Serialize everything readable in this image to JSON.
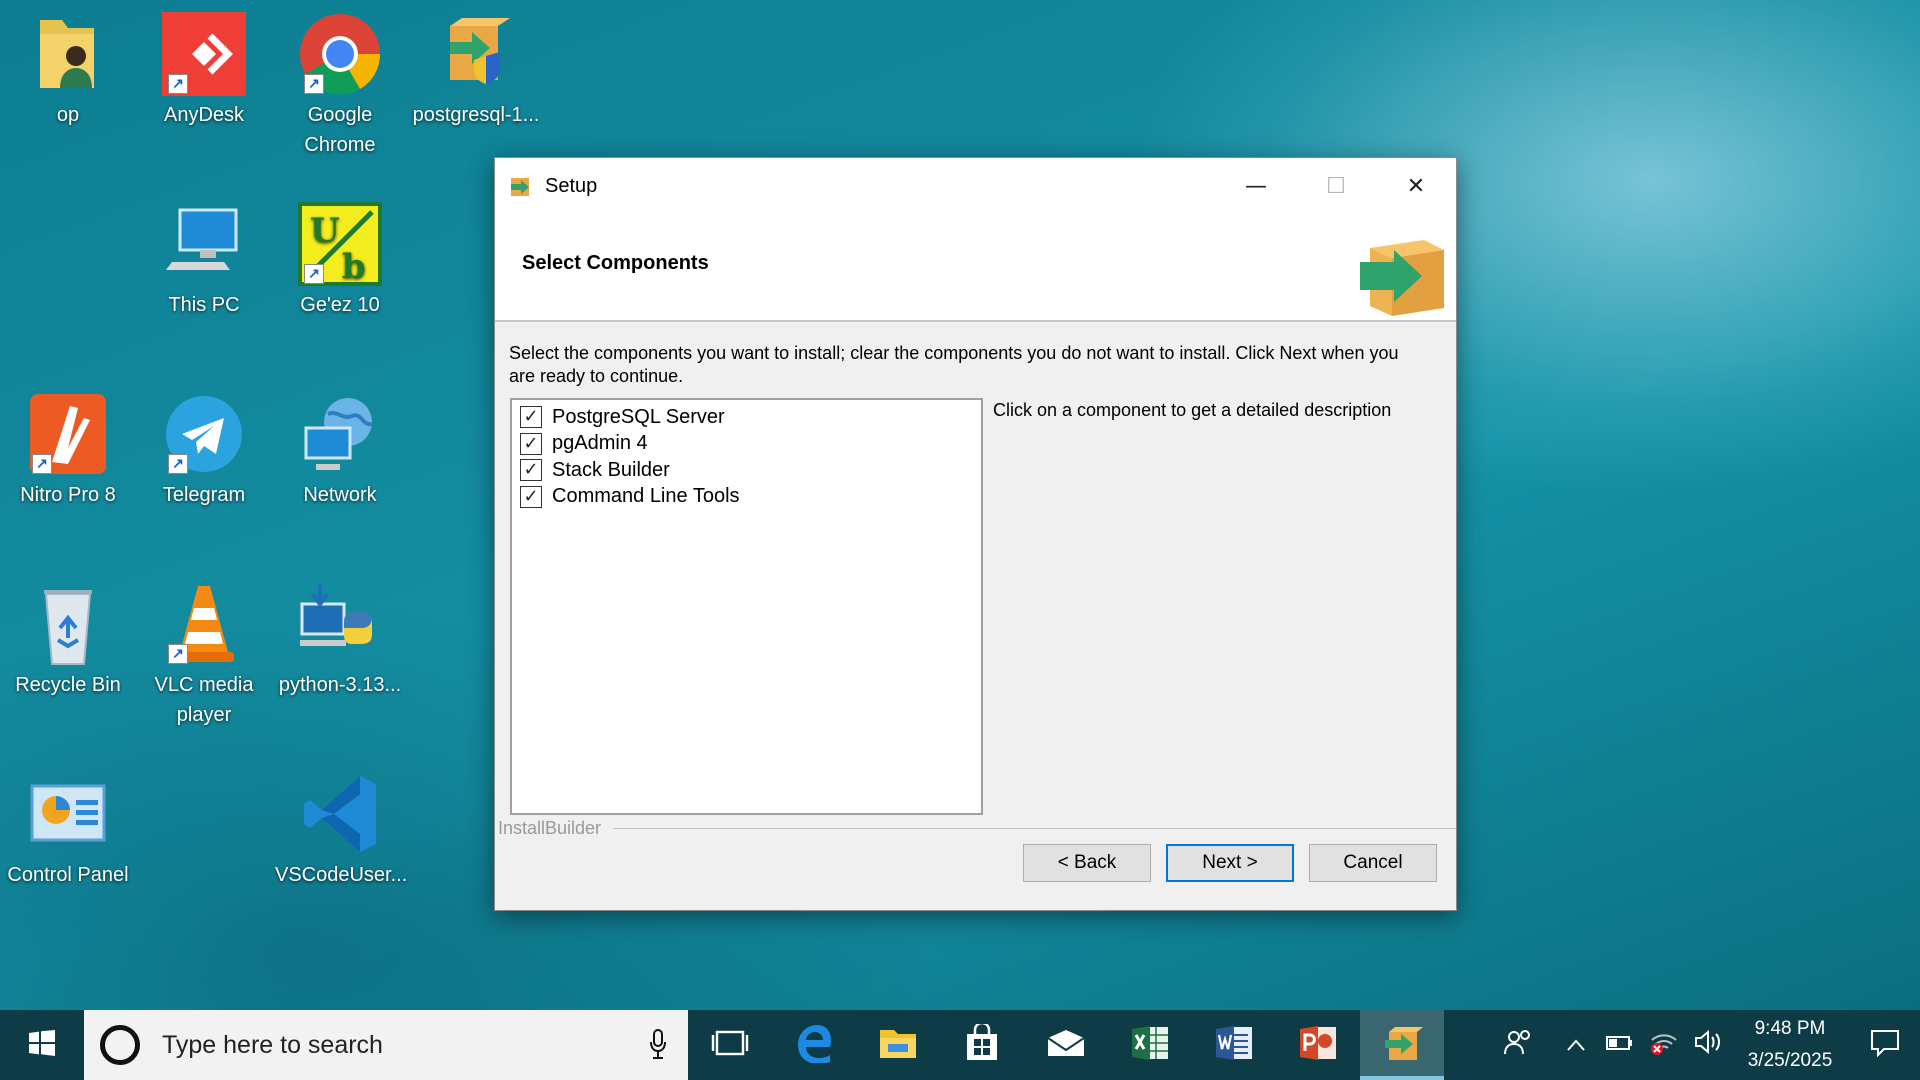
{
  "desktop": {
    "icons": [
      {
        "label": "op",
        "icon": "user-folder-icon"
      },
      {
        "label": "AnyDesk",
        "icon": "anydesk-icon"
      },
      {
        "label": "Google Chrome",
        "icon": "chrome-icon"
      },
      {
        "label": "postgresql-1...",
        "icon": "installer-box-icon"
      },
      {
        "label": "This PC",
        "icon": "computer-icon"
      },
      {
        "label": "Ge'ez 10",
        "icon": "geez-icon"
      },
      {
        "label": "Nitro Pro 8",
        "icon": "nitro-pdf-icon"
      },
      {
        "label": "Telegram",
        "icon": "telegram-icon"
      },
      {
        "label": "Network",
        "icon": "network-globe-icon"
      },
      {
        "label": "Recycle Bin",
        "icon": "recycle-bin-icon"
      },
      {
        "label": "VLC media player",
        "icon": "vlc-cone-icon"
      },
      {
        "label": "python-3.13...",
        "icon": "python-installer-icon"
      },
      {
        "label": "Control Panel",
        "icon": "control-panel-icon"
      },
      {
        "label": "VSCodeUser...",
        "icon": "vscode-icon"
      }
    ]
  },
  "setup": {
    "title": "Setup",
    "heading": "Select Components",
    "instructions": "Select the components you want to install; clear the components you do not want to install. Click Next when you are ready to continue.",
    "components": [
      {
        "label": "PostgreSQL Server",
        "checked": true
      },
      {
        "label": "pgAdmin 4",
        "checked": true
      },
      {
        "label": "Stack Builder",
        "checked": true
      },
      {
        "label": "Command Line Tools",
        "checked": true
      }
    ],
    "description": "Click on a component to get a detailed description",
    "brand": "InstallBuilder",
    "buttons": {
      "back": "< Back",
      "next": "Next >",
      "cancel": "Cancel"
    }
  },
  "taskbar": {
    "search_placeholder": "Type here to search",
    "time": "9:48 PM",
    "date": "3/25/2025"
  },
  "colors": {
    "accent": "#0078d7",
    "taskbar": "#0d3c46",
    "desktop": "#12889c"
  }
}
